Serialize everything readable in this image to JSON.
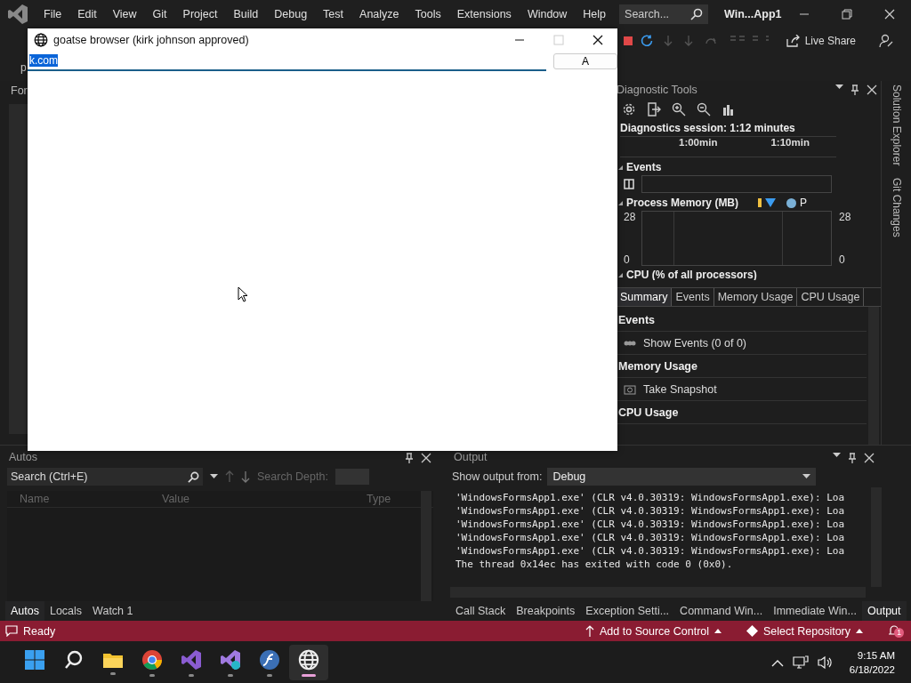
{
  "ide": {
    "menu": [
      "File",
      "Edit",
      "View",
      "Git",
      "Project",
      "Build",
      "Debug",
      "Test",
      "Analyze",
      "Tools",
      "Extensions",
      "Window",
      "Help"
    ],
    "search_placeholder": "Search...",
    "solution_name": "Win...App1",
    "toolbar": {
      "fragment": "p",
      "live_share": "Live Share"
    },
    "document_tab_fragment": "For",
    "diagnostic_tools": {
      "title": "Diagnostic Tools",
      "session": "Diagnostics session: 1:12 minutes",
      "ticks": [
        "1:00min",
        "1:10min"
      ],
      "events_label": "Events",
      "memory_label": "Process Memory (MB)",
      "legend_fragment": "P",
      "memory_axis": {
        "left_max": "28",
        "left_min": "0",
        "right_max": "28",
        "right_min": "0"
      },
      "cpu_label": "CPU (% of all processors)",
      "tabs": [
        {
          "label": "Summary",
          "selected": true
        },
        {
          "label": "Events",
          "selected": false
        },
        {
          "label": "Memory Usage",
          "selected": false
        },
        {
          "label": "CPU Usage",
          "selected": false
        }
      ],
      "list": [
        {
          "kind": "header",
          "label": "Events"
        },
        {
          "kind": "events",
          "label": "Show Events (0 of 0)"
        },
        {
          "kind": "header",
          "label": "Memory Usage"
        },
        {
          "kind": "snapshot",
          "label": "Take Snapshot"
        },
        {
          "kind": "header",
          "label": "CPU Usage"
        }
      ]
    },
    "side_tabs": [
      "Solution Explorer",
      "Git Changes"
    ],
    "autos": {
      "title": "Autos",
      "search_placeholder": "Search (Ctrl+E)",
      "search_depth": "Search Depth:",
      "columns": [
        "Name",
        "Value",
        "Type"
      ],
      "tabs": [
        {
          "label": "Autos",
          "selected": true
        },
        {
          "label": "Locals",
          "selected": false
        },
        {
          "label": "Watch 1",
          "selected": false
        }
      ]
    },
    "output": {
      "title": "Output",
      "show_from_label": "Show output from:",
      "source": "Debug",
      "lines": [
        "'WindowsFormsApp1.exe' (CLR v4.0.30319: WindowsFormsApp1.exe): Loa",
        "'WindowsFormsApp1.exe' (CLR v4.0.30319: WindowsFormsApp1.exe): Loa",
        "'WindowsFormsApp1.exe' (CLR v4.0.30319: WindowsFormsApp1.exe): Loa",
        "'WindowsFormsApp1.exe' (CLR v4.0.30319: WindowsFormsApp1.exe): Loa",
        "'WindowsFormsApp1.exe' (CLR v4.0.30319: WindowsFormsApp1.exe): Loa",
        "The thread 0x14ec has exited with code 0 (0x0)."
      ],
      "tabs": [
        {
          "label": "Call Stack",
          "selected": false
        },
        {
          "label": "Breakpoints",
          "selected": false
        },
        {
          "label": "Exception Setti...",
          "selected": false
        },
        {
          "label": "Command Win...",
          "selected": false
        },
        {
          "label": "Immediate Win...",
          "selected": false
        },
        {
          "label": "Output",
          "selected": true
        }
      ]
    },
    "status_bar": {
      "status": "Ready",
      "source_control": "Add to Source Control",
      "repository": "Select Repository",
      "notification_count": "1"
    },
    "taskbar": {
      "apps": [
        {
          "kind": "start",
          "running": false,
          "selected": false
        },
        {
          "kind": "search",
          "running": false,
          "selected": false
        },
        {
          "kind": "folder",
          "running": true,
          "selected": false
        },
        {
          "kind": "chrome",
          "running": true,
          "selected": false
        },
        {
          "kind": "vs",
          "running": true,
          "selected": false
        },
        {
          "kind": "vs-preview",
          "running": true,
          "selected": false
        },
        {
          "kind": "flash",
          "running": true,
          "selected": false
        },
        {
          "kind": "globe",
          "running": true,
          "selected": true
        }
      ],
      "time": "9:15 AM",
      "date": "6/18/2022"
    }
  },
  "app_window": {
    "title": "goatse browser (kirk johnson approved)",
    "address": "k.com",
    "address_selected": true,
    "button": "A"
  }
}
